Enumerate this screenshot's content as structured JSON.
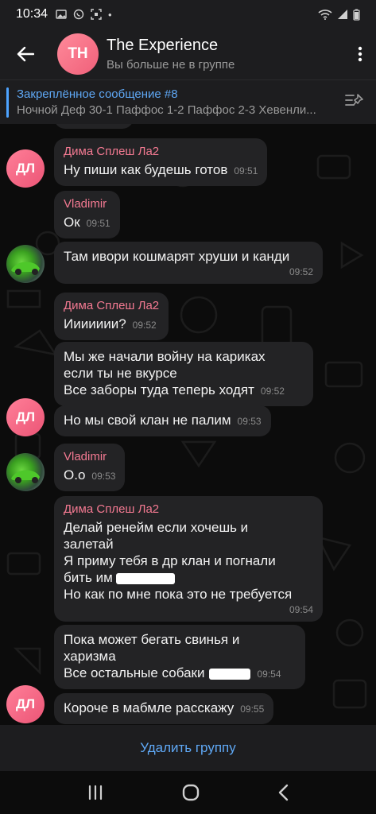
{
  "status": {
    "time": "10:34"
  },
  "header": {
    "avatar_initials": "TH",
    "title": "The Experience",
    "subtitle": "Вы больше не в группе"
  },
  "pinned": {
    "title": "Закреплённое сообщение #8",
    "text": "Ночной Деф  30-1 Паффос 1-2 Паффос 2-3 Хевенли..."
  },
  "messages": [
    {
      "sender": "Дима Сплеш Ла2",
      "text": "Ну пиши как будешь готов",
      "time": "09:51"
    },
    {
      "sender": "Vladimir",
      "text": "Ок",
      "time": "09:51"
    },
    {
      "text": "Там ивори кошмарят хруши и канди",
      "time": "09:52"
    },
    {
      "sender": "Дима Сплеш Ла2",
      "text": "Иииииии?",
      "time": "09:52"
    },
    {
      "lines": [
        "Мы же начали войну на кариках",
        "если ты не вкурсе",
        "Все заборы туда теперь ходят"
      ],
      "time": "09:52"
    },
    {
      "text": "Но мы свой клан не палим",
      "time": "09:53",
      "avatar": "ДЛ"
    },
    {
      "sender": "Vladimir",
      "text": "О.о",
      "time": "09:53"
    },
    {
      "sender": "Дима Сплеш Ла2",
      "lines": [
        "Делай ренейм если хочешь и",
        "залетай",
        "Я приму тебя в др клан и погнали",
        "бить им",
        "Но как по мне пока это не требуется"
      ],
      "time": "09:54"
    },
    {
      "lines": [
        "Пока может бегать свинья и",
        "харизма",
        "Все остальные собаки"
      ],
      "time": "09:54"
    },
    {
      "text": "Короче в мабмле расскажу",
      "time": "09:55",
      "avatar": "ДЛ"
    }
  ],
  "avatars": {
    "dl": "ДЛ"
  },
  "bottom": {
    "delete_label": "Удалить группу"
  },
  "colors": {
    "accent": "#5fa8f5",
    "sender": "#f47a92",
    "bubble": "#232325"
  }
}
